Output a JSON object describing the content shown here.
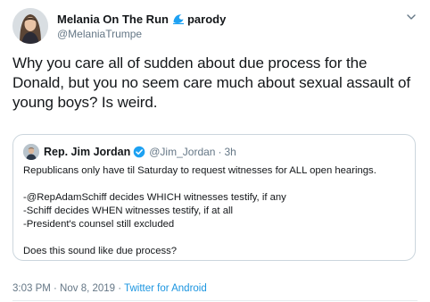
{
  "author": {
    "display_name": "Melania On The Run",
    "badge_text": "parody",
    "handle": "@MelaniaTrumpe",
    "icon": "wave-icon"
  },
  "tweet": {
    "text": "Why you care all of sudden about due process for the Donald, but you no seem care much about sexual assault of young boys?  Is weird."
  },
  "quoted": {
    "name": "Rep. Jim Jordan",
    "handle": "@Jim_Jordan",
    "separator": "·",
    "time": "3h",
    "lines": [
      "Republicans only have til Saturday to request witnesses for ALL open hearings.",
      "",
      "-@RepAdamSchiff decides WHICH witnesses testify, if any",
      "-Schiff decides WHEN witnesses testify, if at all",
      "-President's counsel still excluded",
      "",
      "Does this sound like due process?"
    ]
  },
  "meta": {
    "timestamp": "3:03 PM · Nov 8, 2019 · ",
    "source": "Twitter for Android"
  },
  "colors": {
    "text": "#14171a",
    "secondary": "#657786",
    "link": "#1b95e0",
    "verified": "#1da1f2",
    "border": "#ccd6dd"
  }
}
